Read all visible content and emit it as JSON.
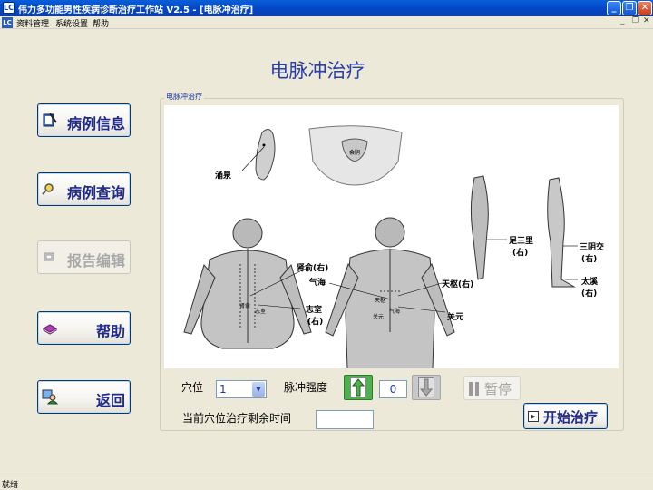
{
  "window": {
    "title": "伟力多功能男性疾病诊断治疗工作站 V2.5 - [电脉冲治疗]",
    "minimize": "_",
    "restore": "❐",
    "close": "✕",
    "app_icon": "LC"
  },
  "menubar": {
    "doc_icon": "LC",
    "items": [
      "资料管理",
      "系统设置",
      "帮助"
    ],
    "mdi_controls": [
      "_",
      "❐",
      "✕"
    ]
  },
  "page_title": "电脉冲治疗",
  "nav": [
    {
      "label": "病例信息",
      "icon": "notebook-pen-icon",
      "enabled": true
    },
    {
      "label": "病例查询",
      "icon": "magnifier-icon",
      "enabled": true
    },
    {
      "label": "报告编辑",
      "icon": "report-edit-icon",
      "enabled": false
    },
    {
      "label": "帮助",
      "icon": "help-book-icon",
      "enabled": true
    },
    {
      "label": "返回",
      "icon": "return-person-icon",
      "enabled": true
    }
  ],
  "group": {
    "caption": "电脉冲治疗",
    "diagram_labels": {
      "yongquan": "涌泉",
      "huiyin": "会阴",
      "zusanli": "足三里",
      "zusanli_side": "(右)",
      "sanyinjiao": "三阴交",
      "sanyinjiao_side": "(右)",
      "taixi": "太溪",
      "taixi_side": "(右)",
      "shenshu": "肾俞(右)",
      "qihai": "气海",
      "zhishi": "志室",
      "zhishi_side": "(右)",
      "tianshu": "天枢(右)",
      "guanyuan": "关元",
      "back_shenshu": "肾俞",
      "back_zhishi": "志室",
      "front_tianshu": "天枢",
      "front_qihai": "气海",
      "front_guanyuan": "关元"
    }
  },
  "controls": {
    "acupoint_label": "穴位",
    "acupoint_value": "1",
    "intensity_label": "脉冲强度",
    "intensity_value": "0",
    "pause_label": "暂停",
    "remaining_label": "当前穴位治疗剩余时间",
    "remaining_value": "",
    "start_label": "开始治疗"
  },
  "statusbar": {
    "text": "就绪"
  },
  "colors": {
    "title_blue": "#2a3fa8",
    "button_text": "#1f2a8a",
    "increase_green": "#4fb04f",
    "disabled_gray": "#a8a8a8"
  }
}
